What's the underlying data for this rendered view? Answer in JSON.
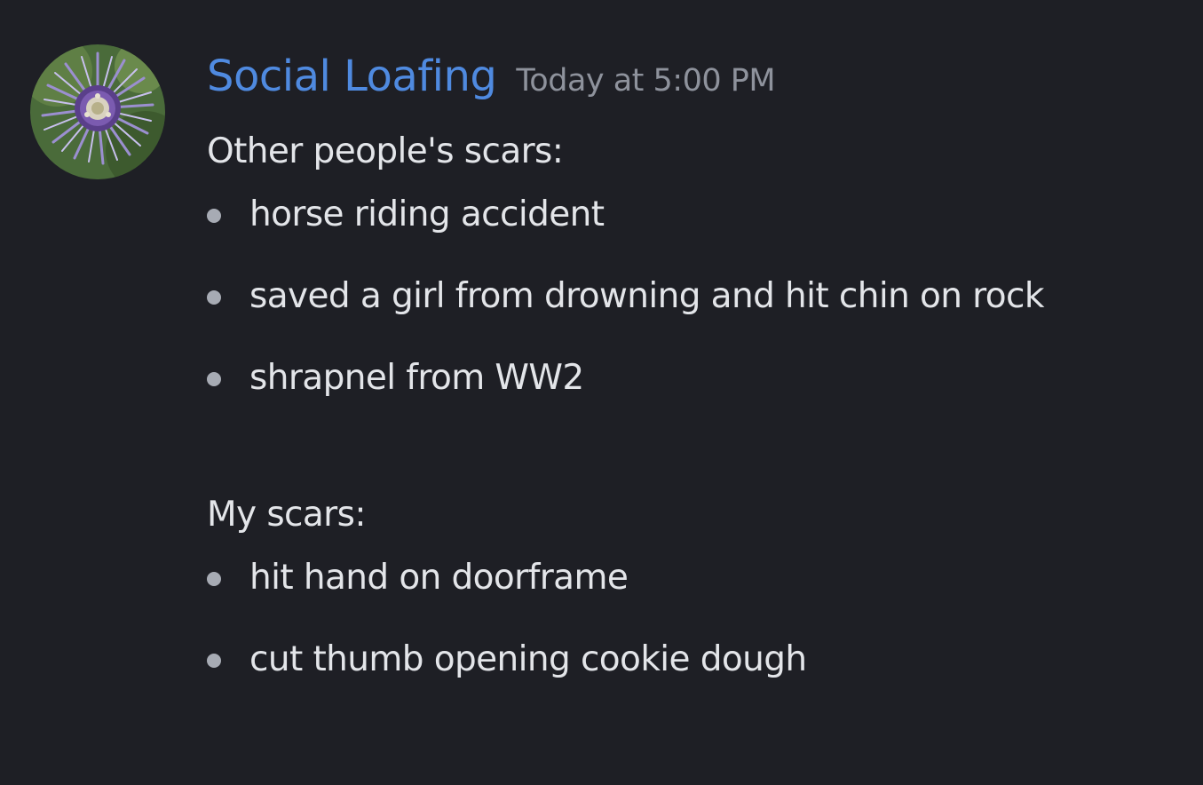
{
  "message": {
    "avatar_icon": "passion-flower-avatar",
    "username": "Social Loafing",
    "username_color": "#4f8ae0",
    "timestamp": "Today at 5:00 PM",
    "paragraph_1": "Other people's scars:",
    "list_1": [
      "horse riding accident",
      "saved a girl from drowning and hit chin on rock",
      "shrapnel from WW2"
    ],
    "paragraph_2": "My scars:",
    "list_2": [
      "hit hand on doorframe",
      "cut thumb opening cookie dough"
    ]
  }
}
